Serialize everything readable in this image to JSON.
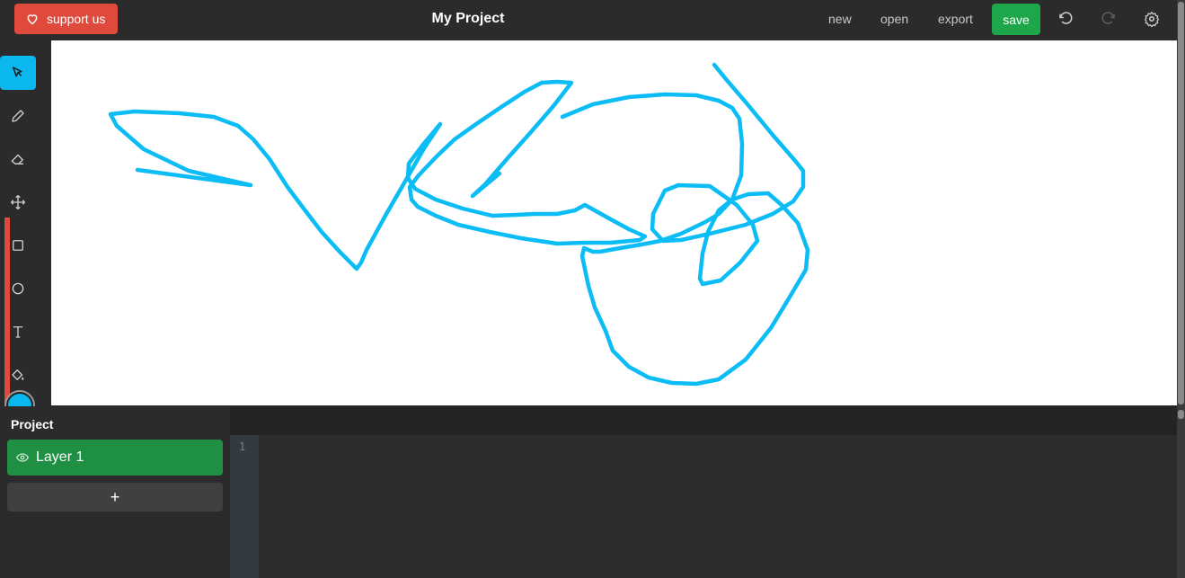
{
  "header": {
    "support_label": "support us",
    "project_title": "My Project",
    "new_label": "new",
    "open_label": "open",
    "export_label": "export",
    "save_label": "save"
  },
  "toolbar": {
    "tools": [
      "select-icon",
      "pencil-icon",
      "eraser-icon",
      "move-icon",
      "rectangle-icon",
      "ellipse-icon",
      "text-icon",
      "fill-icon"
    ],
    "active_tool": "select-icon",
    "current_color": "#0bb7ef"
  },
  "layers": {
    "title": "Project",
    "items": [
      {
        "label": "Layer 1",
        "visible": true
      }
    ],
    "add_label": "+"
  },
  "editor": {
    "line_numbers": [
      "1"
    ]
  },
  "colors": {
    "accent": "#0bb7ef",
    "support": "#e04a3c",
    "save": "#1ea64a",
    "layer_active": "#1e8f43",
    "stroke": "#0bbcf5"
  }
}
